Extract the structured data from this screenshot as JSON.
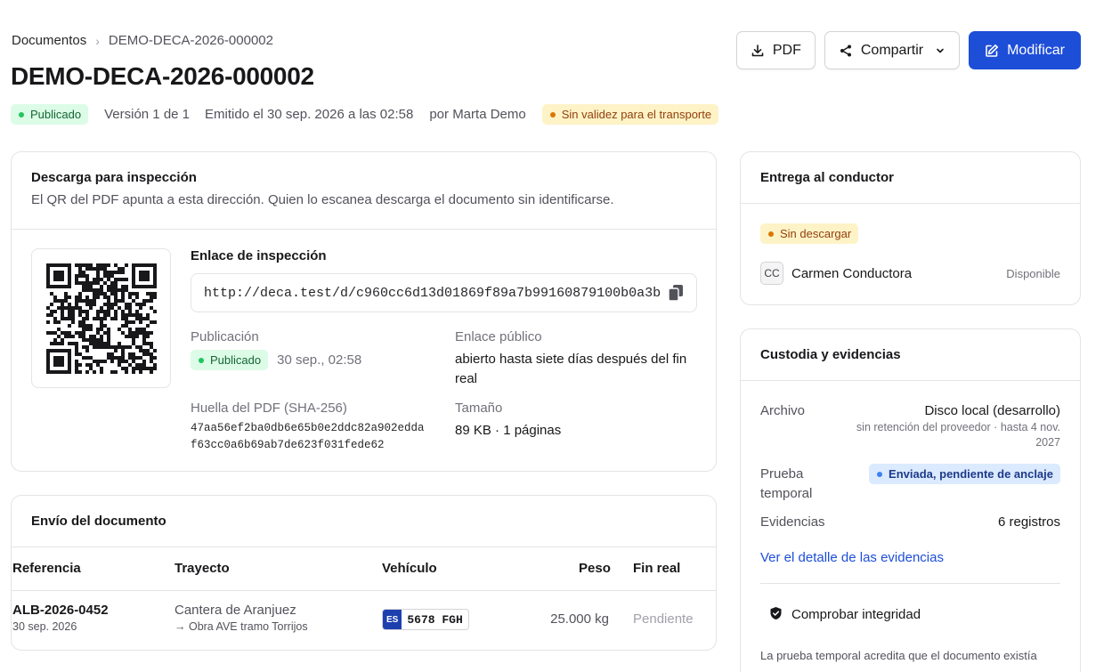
{
  "breadcrumb": {
    "root": "Documentos",
    "separator": "›",
    "current": "DEMO-DECA-2026-000002"
  },
  "page": {
    "title": "DEMO-DECA-2026-000002"
  },
  "meta": {
    "status": "Publicado",
    "version": "Versión 1 de 1",
    "issued": "Emitido el 30 sep. 2026 a las 02:58",
    "author": "por Marta Demo",
    "warning": "Sin validez para el transporte"
  },
  "actions": {
    "pdf": "PDF",
    "share": "Compartir",
    "edit": "Modificar"
  },
  "inspection": {
    "title": "Descarga para inspección",
    "subtitle": "El QR del PDF apunta a esta dirección. Quien lo escanea descarga el documento sin identificarse.",
    "link_label": "Enlace de inspección",
    "link_value": "http://deca.test/d/c960cc6d13d01869f89a7b99160879100b0a3b",
    "publication_label": "Publicación",
    "publication_status": "Publicado",
    "publication_date": "30 sep., 02:58",
    "public_link_label": "Enlace público",
    "public_link_value": "abierto hasta siete días después del fin real",
    "hash_label": "Huella del PDF (SHA-256)",
    "hash_line1": "47aa56ef2ba0db6e65b0e2ddc82a902edda",
    "hash_line2": "f63cc0a6b69ab7de623f031fede62",
    "size_label": "Tamaño",
    "size_value": "89 KB · 1 páginas"
  },
  "shipment": {
    "title": "Envío del documento",
    "columns": [
      "Referencia",
      "Trayecto",
      "Vehículo",
      "Peso",
      "Fin real"
    ],
    "rows": [
      {
        "reference": "ALB-2026-0452",
        "date": "30 sep. 2026",
        "route_from": "Cantera de Aranjuez",
        "route_to": "→ Obra AVE tramo Torrijos",
        "plate_country": "ES",
        "plate_number": "5678 FGH",
        "weight": "25.000 kg",
        "end": "Pendiente"
      }
    ]
  },
  "delivery": {
    "title": "Entrega al conductor",
    "status": "Sin descargar",
    "driver_initials": "CC",
    "driver_name": "Carmen Conductora",
    "driver_state": "Disponible"
  },
  "custody": {
    "title": "Custodia y evidencias",
    "archive_label": "Archivo",
    "archive_value": "Disco local (desarrollo)",
    "archive_note1": "sin retención del proveedor · hasta 4 nov.",
    "archive_note2": "2027",
    "timestamp_label_1": "Prueba",
    "timestamp_label_2": "temporal",
    "timestamp_status": "Enviada, pendiente de anclaje",
    "evidence_label": "Evidencias",
    "evidence_value": "6 registros",
    "evidence_link": "Ver el detalle de las evidencias",
    "integrity_button": "Comprobar integridad",
    "footnote": "La prueba temporal acredita que el documento existía"
  },
  "colors": {
    "primary": "#1d4ed8",
    "success": "#22c55e",
    "warning": "#d97706",
    "border": "#e4e4e7"
  },
  "icons": [
    "download-icon",
    "share-icon",
    "chevron-down-icon",
    "edit-icon",
    "copy-icon",
    "qr-code",
    "shield-check-icon",
    "chevron-right-icon"
  ]
}
